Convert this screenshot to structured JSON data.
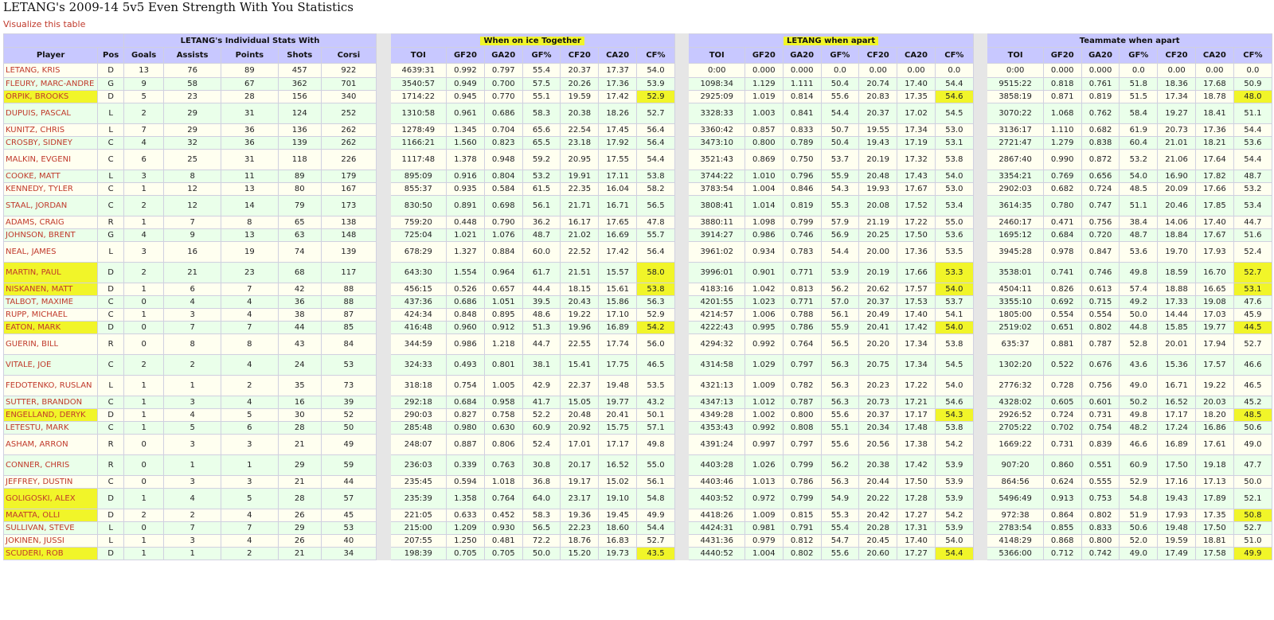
{
  "page": {
    "title": "LETANG's 2009-14 5v5 Even Strength With You Statistics",
    "visualize_link": "Visualize this table"
  },
  "groups": [
    {
      "label": "",
      "span": 2
    },
    {
      "label": "LETANG's Individual Stats With",
      "span": 5
    },
    {
      "label": "When on ice Together",
      "span": 7,
      "highlight": true
    },
    {
      "label": "LETANG when apart",
      "span": 7,
      "highlight": true
    },
    {
      "label": "Teammate when apart",
      "span": 7
    }
  ],
  "columns": [
    "Player",
    "Pos",
    "Goals",
    "Assists",
    "Points",
    "Shots",
    "Corsi",
    "TOI",
    "GF20",
    "GA20",
    "GF%",
    "CF20",
    "CA20",
    "CF%",
    "TOI",
    "GF20",
    "GA20",
    "GF%",
    "CF20",
    "CA20",
    "CF%",
    "TOI",
    "GF20",
    "GA20",
    "GF%",
    "CF20",
    "CA20",
    "CF%"
  ],
  "rows": [
    {
      "cells": [
        "LETANG, KRIS",
        "D",
        "13",
        "76",
        "89",
        "457",
        "922",
        "4639:31",
        "0.992",
        "0.797",
        "55.4",
        "20.37",
        "17.37",
        "54.0",
        "0:00",
        "0.000",
        "0.000",
        "0.0",
        "0.00",
        "0.00",
        "0.0",
        "0:00",
        "0.000",
        "0.000",
        "0.0",
        "0.00",
        "0.00",
        "0.0"
      ]
    },
    {
      "cells": [
        "FLEURY, MARC-ANDRE",
        "G",
        "9",
        "58",
        "67",
        "362",
        "701",
        "3540:57",
        "0.949",
        "0.700",
        "57.5",
        "20.26",
        "17.36",
        "53.9",
        "1098:34",
        "1.129",
        "1.111",
        "50.4",
        "20.74",
        "17.40",
        "54.4",
        "9515:22",
        "0.818",
        "0.761",
        "51.8",
        "18.36",
        "17.68",
        "50.9"
      ]
    },
    {
      "cells": [
        "ORPIK, BROOKS",
        "D",
        "5",
        "23",
        "28",
        "156",
        "340",
        "1714:22",
        "0.945",
        "0.770",
        "55.1",
        "19.59",
        "17.42",
        "52.9",
        "2925:09",
        "1.019",
        "0.814",
        "55.6",
        "20.83",
        "17.35",
        "54.6",
        "3858:19",
        "0.871",
        "0.819",
        "51.5",
        "17.34",
        "18.78",
        "48.0"
      ],
      "hl": [
        0,
        13,
        20,
        27
      ]
    },
    {
      "cells": [
        "DUPUIS, PASCAL",
        "L",
        "2",
        "29",
        "31",
        "124",
        "252",
        "1310:58",
        "0.961",
        "0.686",
        "58.3",
        "20.38",
        "18.26",
        "52.7",
        "3328:33",
        "1.003",
        "0.841",
        "54.4",
        "20.37",
        "17.02",
        "54.5",
        "3070:22",
        "1.068",
        "0.762",
        "58.4",
        "19.27",
        "18.41",
        "51.1"
      ]
    },
    {
      "cells": [
        "KUNITZ, CHRIS",
        "L",
        "7",
        "29",
        "36",
        "136",
        "262",
        "1278:49",
        "1.345",
        "0.704",
        "65.6",
        "22.54",
        "17.45",
        "56.4",
        "3360:42",
        "0.857",
        "0.833",
        "50.7",
        "19.55",
        "17.34",
        "53.0",
        "3136:17",
        "1.110",
        "0.682",
        "61.9",
        "20.73",
        "17.36",
        "54.4"
      ]
    },
    {
      "cells": [
        "CROSBY, SIDNEY",
        "C",
        "4",
        "32",
        "36",
        "139",
        "262",
        "1166:21",
        "1.560",
        "0.823",
        "65.5",
        "23.18",
        "17.92",
        "56.4",
        "3473:10",
        "0.800",
        "0.789",
        "50.4",
        "19.43",
        "17.19",
        "53.1",
        "2721:47",
        "1.279",
        "0.838",
        "60.4",
        "21.01",
        "18.21",
        "53.6"
      ]
    },
    {
      "cells": [
        "MALKIN, EVGENI",
        "C",
        "6",
        "25",
        "31",
        "118",
        "226",
        "1117:48",
        "1.378",
        "0.948",
        "59.2",
        "20.95",
        "17.55",
        "54.4",
        "3521:43",
        "0.869",
        "0.750",
        "53.7",
        "20.19",
        "17.32",
        "53.8",
        "2867:40",
        "0.990",
        "0.872",
        "53.2",
        "21.06",
        "17.64",
        "54.4"
      ]
    },
    {
      "cells": [
        "COOKE, MATT",
        "L",
        "3",
        "8",
        "11",
        "89",
        "179",
        "895:09",
        "0.916",
        "0.804",
        "53.2",
        "19.91",
        "17.11",
        "53.8",
        "3744:22",
        "1.010",
        "0.796",
        "55.9",
        "20.48",
        "17.43",
        "54.0",
        "3354:21",
        "0.769",
        "0.656",
        "54.0",
        "16.90",
        "17.82",
        "48.7"
      ]
    },
    {
      "cells": [
        "KENNEDY, TYLER",
        "C",
        "1",
        "12",
        "13",
        "80",
        "167",
        "855:37",
        "0.935",
        "0.584",
        "61.5",
        "22.35",
        "16.04",
        "58.2",
        "3783:54",
        "1.004",
        "0.846",
        "54.3",
        "19.93",
        "17.67",
        "53.0",
        "2902:03",
        "0.682",
        "0.724",
        "48.5",
        "20.09",
        "17.66",
        "53.2"
      ]
    },
    {
      "cells": [
        "STAAL, JORDAN",
        "C",
        "2",
        "12",
        "14",
        "79",
        "173",
        "830:50",
        "0.891",
        "0.698",
        "56.1",
        "21.71",
        "16.71",
        "56.5",
        "3808:41",
        "1.014",
        "0.819",
        "55.3",
        "20.08",
        "17.52",
        "53.4",
        "3614:35",
        "0.780",
        "0.747",
        "51.1",
        "20.46",
        "17.85",
        "53.4"
      ]
    },
    {
      "cells": [
        "ADAMS, CRAIG",
        "R",
        "1",
        "7",
        "8",
        "65",
        "138",
        "759:20",
        "0.448",
        "0.790",
        "36.2",
        "16.17",
        "17.65",
        "47.8",
        "3880:11",
        "1.098",
        "0.799",
        "57.9",
        "21.19",
        "17.22",
        "55.0",
        "2460:17",
        "0.471",
        "0.756",
        "38.4",
        "14.06",
        "17.40",
        "44.7"
      ]
    },
    {
      "cells": [
        "JOHNSON, BRENT",
        "G",
        "4",
        "9",
        "13",
        "63",
        "148",
        "725:04",
        "1.021",
        "1.076",
        "48.7",
        "21.02",
        "16.69",
        "55.7",
        "3914:27",
        "0.986",
        "0.746",
        "56.9",
        "20.25",
        "17.50",
        "53.6",
        "1695:12",
        "0.684",
        "0.720",
        "48.7",
        "18.84",
        "17.67",
        "51.6"
      ]
    },
    {
      "cells": [
        "NEAL, JAMES",
        "L",
        "3",
        "16",
        "19",
        "74",
        "139",
        "678:29",
        "1.327",
        "0.884",
        "60.0",
        "22.52",
        "17.42",
        "56.4",
        "3961:02",
        "0.934",
        "0.783",
        "54.4",
        "20.00",
        "17.36",
        "53.5",
        "3945:28",
        "0.978",
        "0.847",
        "53.6",
        "19.70",
        "17.93",
        "52.4"
      ]
    },
    {
      "cells": [
        "MARTIN, PAUL",
        "D",
        "2",
        "21",
        "23",
        "68",
        "117",
        "643:30",
        "1.554",
        "0.964",
        "61.7",
        "21.51",
        "15.57",
        "58.0",
        "3996:01",
        "0.901",
        "0.771",
        "53.9",
        "20.19",
        "17.66",
        "53.3",
        "3538:01",
        "0.741",
        "0.746",
        "49.8",
        "18.59",
        "16.70",
        "52.7"
      ],
      "hl": [
        0,
        13,
        20,
        27
      ]
    },
    {
      "cells": [
        "NISKANEN, MATT",
        "D",
        "1",
        "6",
        "7",
        "42",
        "88",
        "456:15",
        "0.526",
        "0.657",
        "44.4",
        "18.15",
        "15.61",
        "53.8",
        "4183:16",
        "1.042",
        "0.813",
        "56.2",
        "20.62",
        "17.57",
        "54.0",
        "4504:11",
        "0.826",
        "0.613",
        "57.4",
        "18.88",
        "16.65",
        "53.1"
      ],
      "hl": [
        0,
        13,
        20,
        27
      ]
    },
    {
      "cells": [
        "TALBOT, MAXIME",
        "C",
        "0",
        "4",
        "4",
        "36",
        "88",
        "437:36",
        "0.686",
        "1.051",
        "39.5",
        "20.43",
        "15.86",
        "56.3",
        "4201:55",
        "1.023",
        "0.771",
        "57.0",
        "20.37",
        "17.53",
        "53.7",
        "3355:10",
        "0.692",
        "0.715",
        "49.2",
        "17.33",
        "19.08",
        "47.6"
      ]
    },
    {
      "cells": [
        "RUPP, MICHAEL",
        "C",
        "1",
        "3",
        "4",
        "38",
        "87",
        "424:34",
        "0.848",
        "0.895",
        "48.6",
        "19.22",
        "17.10",
        "52.9",
        "4214:57",
        "1.006",
        "0.788",
        "56.1",
        "20.49",
        "17.40",
        "54.1",
        "1805:00",
        "0.554",
        "0.554",
        "50.0",
        "14.44",
        "17.03",
        "45.9"
      ]
    },
    {
      "cells": [
        "EATON, MARK",
        "D",
        "0",
        "7",
        "7",
        "44",
        "85",
        "416:48",
        "0.960",
        "0.912",
        "51.3",
        "19.96",
        "16.89",
        "54.2",
        "4222:43",
        "0.995",
        "0.786",
        "55.9",
        "20.41",
        "17.42",
        "54.0",
        "2519:02",
        "0.651",
        "0.802",
        "44.8",
        "15.85",
        "19.77",
        "44.5"
      ],
      "hl": [
        0,
        13,
        20,
        27
      ]
    },
    {
      "cells": [
        "GUERIN, BILL",
        "R",
        "0",
        "8",
        "8",
        "43",
        "84",
        "344:59",
        "0.986",
        "1.218",
        "44.7",
        "22.55",
        "17.74",
        "56.0",
        "4294:32",
        "0.992",
        "0.764",
        "56.5",
        "20.20",
        "17.34",
        "53.8",
        "635:37",
        "0.881",
        "0.787",
        "52.8",
        "20.01",
        "17.94",
        "52.7"
      ]
    },
    {
      "cells": [
        "VITALE, JOE",
        "C",
        "2",
        "2",
        "4",
        "24",
        "53",
        "324:33",
        "0.493",
        "0.801",
        "38.1",
        "15.41",
        "17.75",
        "46.5",
        "4314:58",
        "1.029",
        "0.797",
        "56.3",
        "20.75",
        "17.34",
        "54.5",
        "1302:20",
        "0.522",
        "0.676",
        "43.6",
        "15.36",
        "17.57",
        "46.6"
      ]
    },
    {
      "cells": [
        "FEDOTENKO, RUSLAN",
        "L",
        "1",
        "1",
        "2",
        "35",
        "73",
        "318:18",
        "0.754",
        "1.005",
        "42.9",
        "22.37",
        "19.48",
        "53.5",
        "4321:13",
        "1.009",
        "0.782",
        "56.3",
        "20.23",
        "17.22",
        "54.0",
        "2776:32",
        "0.728",
        "0.756",
        "49.0",
        "16.71",
        "19.22",
        "46.5"
      ]
    },
    {
      "cells": [
        "SUTTER, BRANDON",
        "C",
        "1",
        "3",
        "4",
        "16",
        "39",
        "292:18",
        "0.684",
        "0.958",
        "41.7",
        "15.05",
        "19.77",
        "43.2",
        "4347:13",
        "1.012",
        "0.787",
        "56.3",
        "20.73",
        "17.21",
        "54.6",
        "4328:02",
        "0.605",
        "0.601",
        "50.2",
        "16.52",
        "20.03",
        "45.2"
      ]
    },
    {
      "cells": [
        "ENGELLAND, DERYK",
        "D",
        "1",
        "4",
        "5",
        "30",
        "52",
        "290:03",
        "0.827",
        "0.758",
        "52.2",
        "20.48",
        "20.41",
        "50.1",
        "4349:28",
        "1.002",
        "0.800",
        "55.6",
        "20.37",
        "17.17",
        "54.3",
        "2926:52",
        "0.724",
        "0.731",
        "49.8",
        "17.17",
        "18.20",
        "48.5"
      ],
      "hl": [
        0,
        20,
        27
      ]
    },
    {
      "cells": [
        "LETESTU, MARK",
        "C",
        "1",
        "5",
        "6",
        "28",
        "50",
        "285:48",
        "0.980",
        "0.630",
        "60.9",
        "20.92",
        "15.75",
        "57.1",
        "4353:43",
        "0.992",
        "0.808",
        "55.1",
        "20.34",
        "17.48",
        "53.8",
        "2705:22",
        "0.702",
        "0.754",
        "48.2",
        "17.24",
        "16.86",
        "50.6"
      ]
    },
    {
      "cells": [
        "ASHAM, ARRON",
        "R",
        "0",
        "3",
        "3",
        "21",
        "49",
        "248:07",
        "0.887",
        "0.806",
        "52.4",
        "17.01",
        "17.17",
        "49.8",
        "4391:24",
        "0.997",
        "0.797",
        "55.6",
        "20.56",
        "17.38",
        "54.2",
        "1669:22",
        "0.731",
        "0.839",
        "46.6",
        "16.89",
        "17.61",
        "49.0"
      ]
    },
    {
      "cells": [
        "CONNER, CHRIS",
        "R",
        "0",
        "1",
        "1",
        "29",
        "59",
        "236:03",
        "0.339",
        "0.763",
        "30.8",
        "20.17",
        "16.52",
        "55.0",
        "4403:28",
        "1.026",
        "0.799",
        "56.2",
        "20.38",
        "17.42",
        "53.9",
        "907:20",
        "0.860",
        "0.551",
        "60.9",
        "17.50",
        "19.18",
        "47.7"
      ]
    },
    {
      "cells": [
        "JEFFREY, DUSTIN",
        "C",
        "0",
        "3",
        "3",
        "21",
        "44",
        "235:45",
        "0.594",
        "1.018",
        "36.8",
        "19.17",
        "15.02",
        "56.1",
        "4403:46",
        "1.013",
        "0.786",
        "56.3",
        "20.44",
        "17.50",
        "53.9",
        "864:56",
        "0.624",
        "0.555",
        "52.9",
        "17.16",
        "17.13",
        "50.0"
      ]
    },
    {
      "cells": [
        "GOLIGOSKI, ALEX",
        "D",
        "1",
        "4",
        "5",
        "28",
        "57",
        "235:39",
        "1.358",
        "0.764",
        "64.0",
        "23.17",
        "19.10",
        "54.8",
        "4403:52",
        "0.972",
        "0.799",
        "54.9",
        "20.22",
        "17.28",
        "53.9",
        "5496:49",
        "0.913",
        "0.753",
        "54.8",
        "19.43",
        "17.89",
        "52.1"
      ],
      "hl": [
        0
      ]
    },
    {
      "cells": [
        "MAATTA, OLLI",
        "D",
        "2",
        "2",
        "4",
        "26",
        "45",
        "221:05",
        "0.633",
        "0.452",
        "58.3",
        "19.36",
        "19.45",
        "49.9",
        "4418:26",
        "1.009",
        "0.815",
        "55.3",
        "20.42",
        "17.27",
        "54.2",
        "972:38",
        "0.864",
        "0.802",
        "51.9",
        "17.93",
        "17.35",
        "50.8"
      ],
      "hl": [
        0,
        27
      ]
    },
    {
      "cells": [
        "SULLIVAN, STEVE",
        "L",
        "0",
        "7",
        "7",
        "29",
        "53",
        "215:00",
        "1.209",
        "0.930",
        "56.5",
        "22.23",
        "18.60",
        "54.4",
        "4424:31",
        "0.981",
        "0.791",
        "55.4",
        "20.28",
        "17.31",
        "53.9",
        "2783:54",
        "0.855",
        "0.833",
        "50.6",
        "19.48",
        "17.50",
        "52.7"
      ]
    },
    {
      "cells": [
        "JOKINEN, JUSSI",
        "L",
        "1",
        "3",
        "4",
        "26",
        "40",
        "207:55",
        "1.250",
        "0.481",
        "72.2",
        "18.76",
        "16.83",
        "52.7",
        "4431:36",
        "0.979",
        "0.812",
        "54.7",
        "20.45",
        "17.40",
        "54.0",
        "4148:29",
        "0.868",
        "0.800",
        "52.0",
        "19.59",
        "18.81",
        "51.0"
      ]
    },
    {
      "cells": [
        "SCUDERI, ROB",
        "D",
        "1",
        "1",
        "2",
        "21",
        "34",
        "198:39",
        "0.705",
        "0.705",
        "50.0",
        "15.20",
        "19.73",
        "43.5",
        "4440:52",
        "1.004",
        "0.802",
        "55.6",
        "20.60",
        "17.27",
        "54.4",
        "5366:00",
        "0.712",
        "0.742",
        "49.0",
        "17.49",
        "17.58",
        "49.9"
      ],
      "hl": [
        0,
        13,
        20,
        27
      ]
    }
  ]
}
